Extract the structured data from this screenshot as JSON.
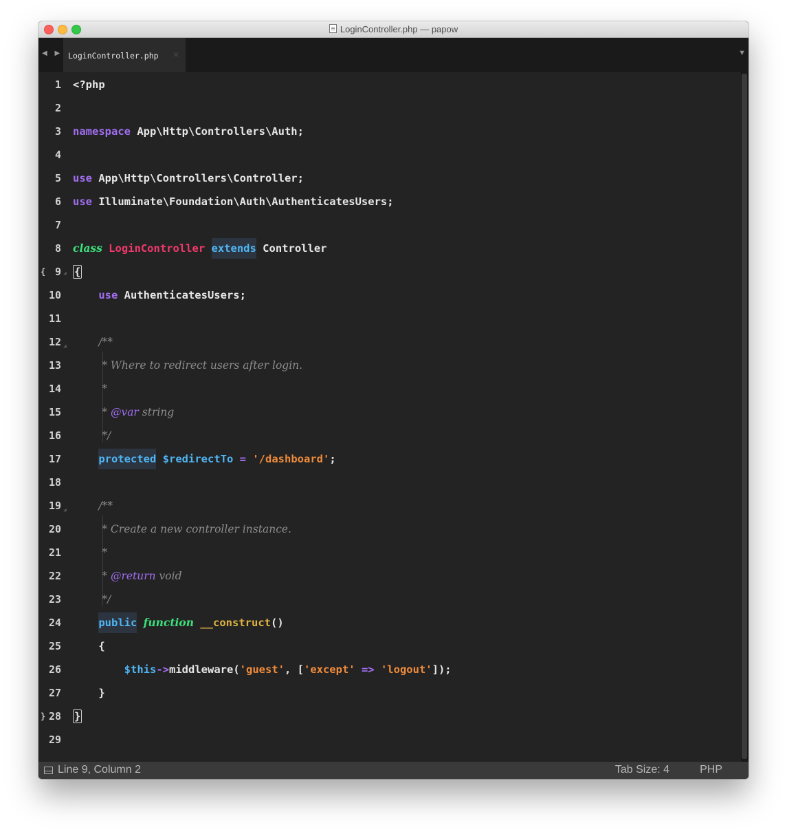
{
  "window": {
    "title": "LoginController.php — papow"
  },
  "tabs": [
    {
      "label": "LoginController.php",
      "close": "×"
    }
  ],
  "nav": {
    "arrows": "◀ ▶",
    "tab_menu": "▼"
  },
  "status": {
    "position": "Line 9, Column 2",
    "tab_size": "Tab Size: 4",
    "syntax": "PHP"
  },
  "gutter": {
    "fold_open": "{",
    "fold_close": "}"
  },
  "code": {
    "l1": "<?php",
    "l3_kw": "namespace",
    "l3_rest": " App\\Http\\Controllers\\Auth;",
    "l5_kw": "use",
    "l5_rest": " App\\Http\\Controllers\\Controller;",
    "l6_kw": "use",
    "l6_rest": " Illuminate\\Foundation\\Auth\\AuthenticatesUsers;",
    "l8_class": "class",
    "l8_name": "LoginController",
    "l8_ext": "extends",
    "l8_parent": "Controller",
    "l9": "{",
    "l10_kw": "use",
    "l10_rest": " AuthenticatesUsers;",
    "l12": "/**",
    "l13": " * Where to redirect users after login.",
    "l14": " *",
    "l15_pre": " * ",
    "l15_tag": "@var",
    "l15_rest": " string",
    "l16": " */",
    "l17_kw": "protected",
    "l17_var": "$redirectTo",
    "l17_eq": " = ",
    "l17_str": "'/dashboard'",
    "l17_end": ";",
    "l19": "/**",
    "l20": " * Create a new controller instance.",
    "l21": " *",
    "l22_pre": " * ",
    "l22_tag": "@return",
    "l22_rest": " void",
    "l23": " */",
    "l24_kw": "public",
    "l24_fn": "function",
    "l24_name": "__construct",
    "l24_end": "()",
    "l25": "{",
    "l26_this": "$this",
    "l26_arrow": "->",
    "l26_call": "middleware(",
    "l26_s1": "'guest'",
    "l26_c1": ", [",
    "l26_s2": "'except'",
    "l26_arr": " => ",
    "l26_s3": "'logout'",
    "l26_end": "]);",
    "l27": "}",
    "l28": "}"
  },
  "colors": {
    "keyword": "#a16ef0",
    "storage": "#4fb6f4",
    "class_kw": "#3de07a",
    "class_name": "#f0396a",
    "string": "#f08b3a",
    "function_name": "#e0b341",
    "comment": "#8c8c8c",
    "background": "#232324"
  }
}
